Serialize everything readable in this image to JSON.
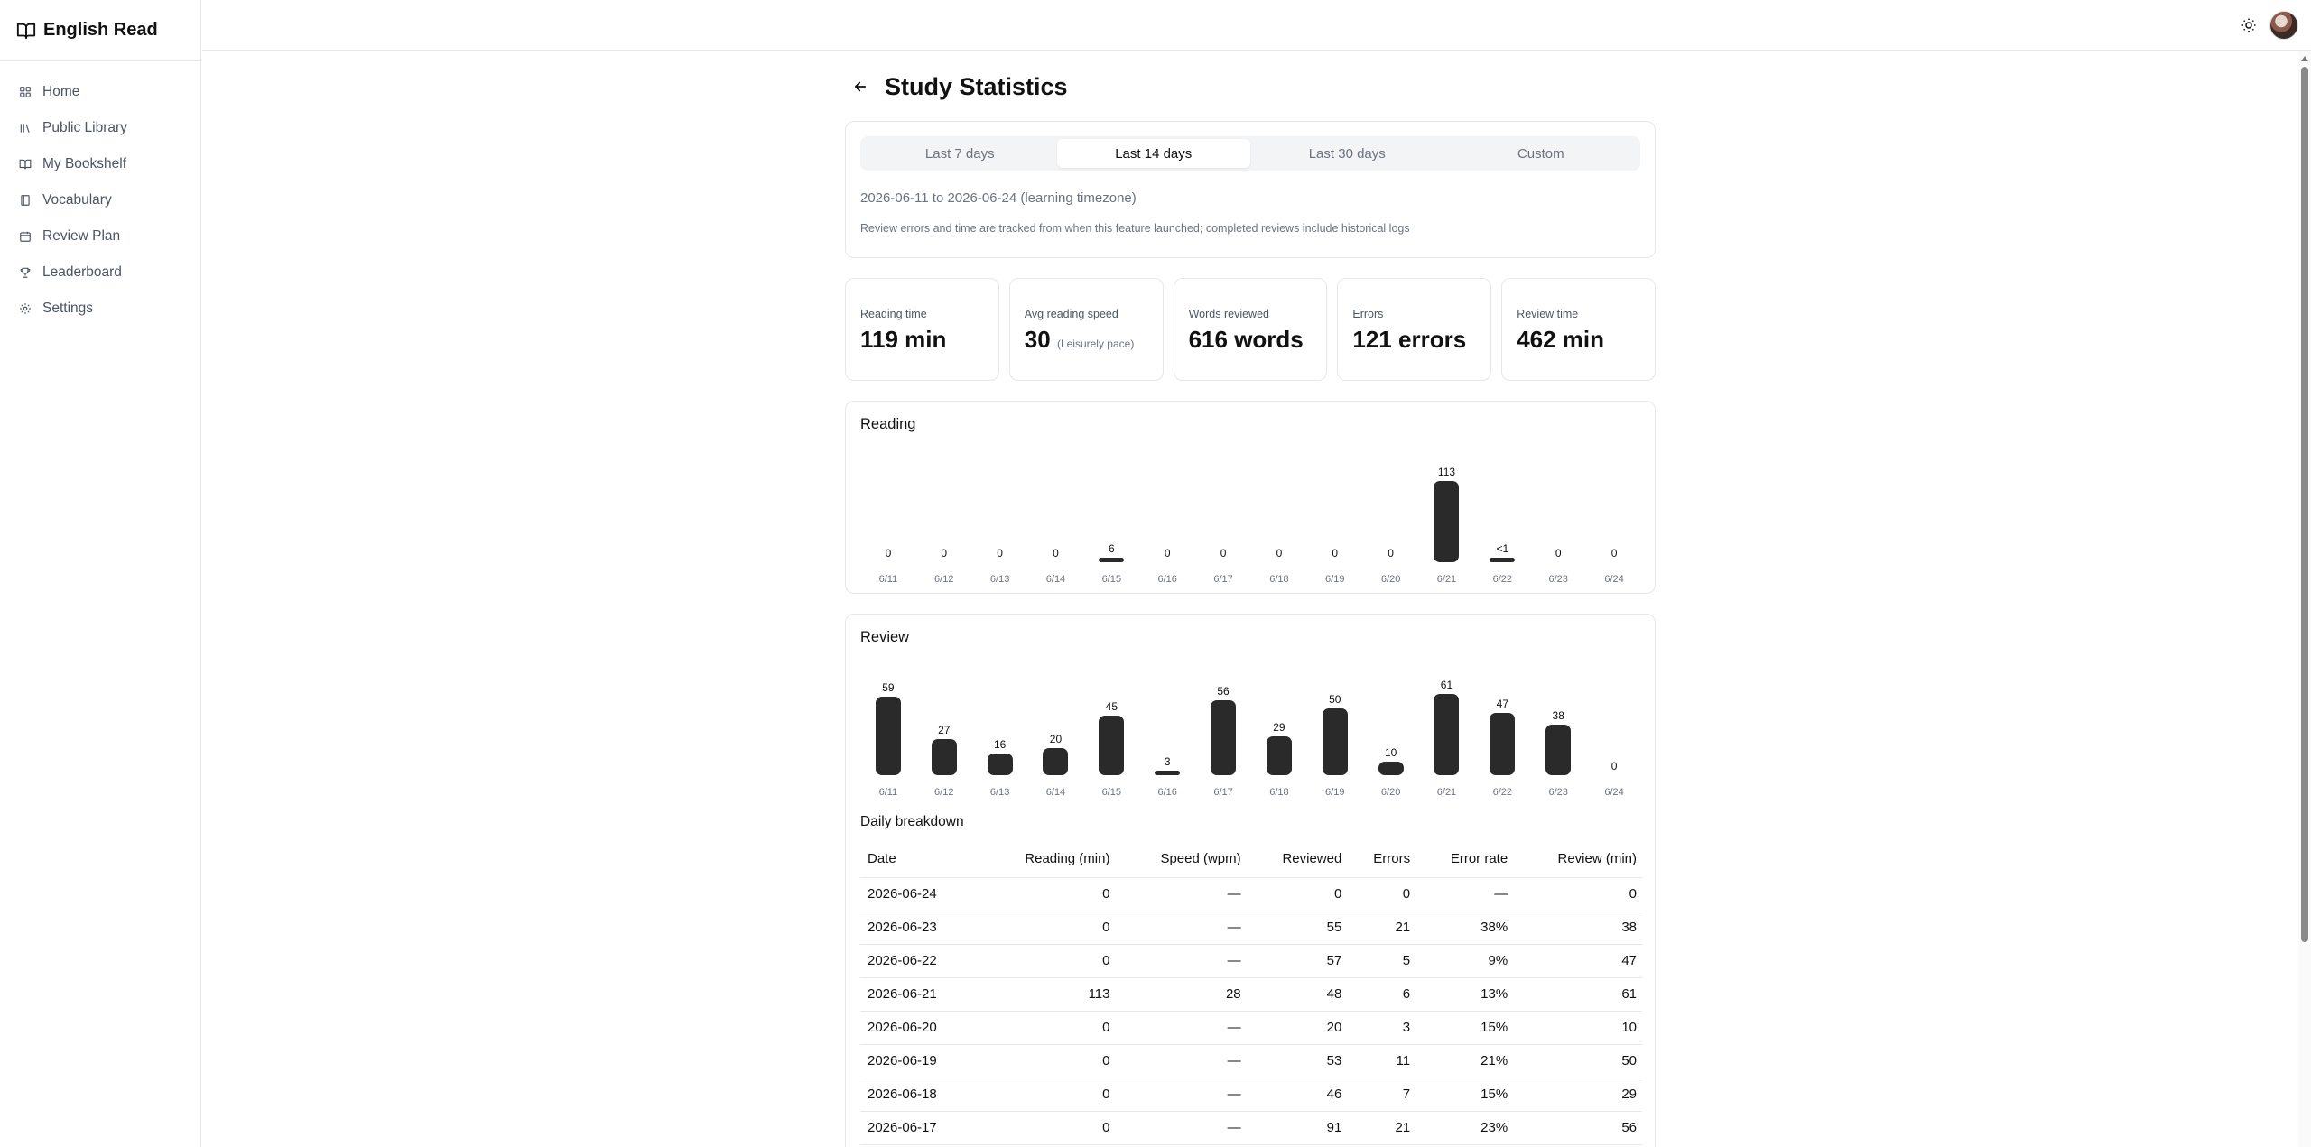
{
  "brand": {
    "name": "English Read",
    "icon": "book-open-icon"
  },
  "sidebar": {
    "items": [
      {
        "label": "Home",
        "icon": "grid-icon"
      },
      {
        "label": "Public Library",
        "icon": "library-icon"
      },
      {
        "label": "My Bookshelf",
        "icon": "book-open-icon"
      },
      {
        "label": "Vocabulary",
        "icon": "notebook-icon"
      },
      {
        "label": "Review Plan",
        "icon": "calendar-icon"
      },
      {
        "label": "Leaderboard",
        "icon": "trophy-icon"
      },
      {
        "label": "Settings",
        "icon": "gear-icon"
      }
    ]
  },
  "header": {
    "theme_icon": "sun-icon",
    "avatar": "user-avatar"
  },
  "page": {
    "title": "Study Statistics",
    "tabs": [
      {
        "label": "Last 7 days",
        "active": false
      },
      {
        "label": "Last 14 days",
        "active": true
      },
      {
        "label": "Last 30 days",
        "active": false
      },
      {
        "label": "Custom",
        "active": false
      }
    ],
    "range_text": "2026-06-11 to 2026-06-24 (learning timezone)",
    "range_note": "Review errors and time are tracked from when this feature launched; completed reviews include historical logs"
  },
  "stats": {
    "reading_time": {
      "label": "Reading time",
      "value": "119 min"
    },
    "avg_speed": {
      "label": "Avg reading speed",
      "value": "30",
      "sub": "(Leisurely pace)"
    },
    "words_reviewed": {
      "label": "Words reviewed",
      "value": "616 words"
    },
    "errors": {
      "label": "Errors",
      "value": "121 errors"
    },
    "review_time": {
      "label": "Review time",
      "value": "462 min"
    }
  },
  "chart_data": [
    {
      "type": "bar",
      "title": "Reading",
      "categories": [
        "6/11",
        "6/12",
        "6/13",
        "6/14",
        "6/15",
        "6/16",
        "6/17",
        "6/18",
        "6/19",
        "6/20",
        "6/21",
        "6/22",
        "6/23",
        "6/24"
      ],
      "values": [
        0,
        0,
        0,
        0,
        6,
        0,
        0,
        0,
        0,
        0,
        113,
        0.5,
        0,
        0
      ],
      "labels": [
        "0",
        "0",
        "0",
        "0",
        "6",
        "0",
        "0",
        "0",
        "0",
        "0",
        "113",
        "<1",
        "0",
        "0"
      ]
    },
    {
      "type": "bar",
      "title": "Review",
      "categories": [
        "6/11",
        "6/12",
        "6/13",
        "6/14",
        "6/15",
        "6/16",
        "6/17",
        "6/18",
        "6/19",
        "6/20",
        "6/21",
        "6/22",
        "6/23",
        "6/24"
      ],
      "values": [
        59,
        27,
        16,
        20,
        45,
        3,
        56,
        29,
        50,
        10,
        61,
        47,
        38,
        0
      ],
      "labels": [
        "59",
        "27",
        "16",
        "20",
        "45",
        "3",
        "56",
        "29",
        "50",
        "10",
        "61",
        "47",
        "38",
        "0"
      ]
    }
  ],
  "breakdown": {
    "title": "Daily breakdown",
    "headers": [
      "Date",
      "Reading (min)",
      "Speed (wpm)",
      "Reviewed",
      "Errors",
      "Error rate",
      "Review (min)"
    ],
    "rows": [
      [
        "2026-06-24",
        "0",
        "—",
        "0",
        "0",
        "—",
        "0"
      ],
      [
        "2026-06-23",
        "0",
        "—",
        "55",
        "21",
        "38%",
        "38"
      ],
      [
        "2026-06-22",
        "0",
        "—",
        "57",
        "5",
        "9%",
        "47"
      ],
      [
        "2026-06-21",
        "113",
        "28",
        "48",
        "6",
        "13%",
        "61"
      ],
      [
        "2026-06-20",
        "0",
        "—",
        "20",
        "3",
        "15%",
        "10"
      ],
      [
        "2026-06-19",
        "0",
        "—",
        "53",
        "11",
        "21%",
        "50"
      ],
      [
        "2026-06-18",
        "0",
        "—",
        "46",
        "7",
        "15%",
        "29"
      ],
      [
        "2026-06-17",
        "0",
        "—",
        "91",
        "21",
        "23%",
        "56"
      ]
    ]
  },
  "colors": {
    "bar": "#2a2a2a",
    "border": "#e5e7eb",
    "muted": "#6b7280"
  }
}
